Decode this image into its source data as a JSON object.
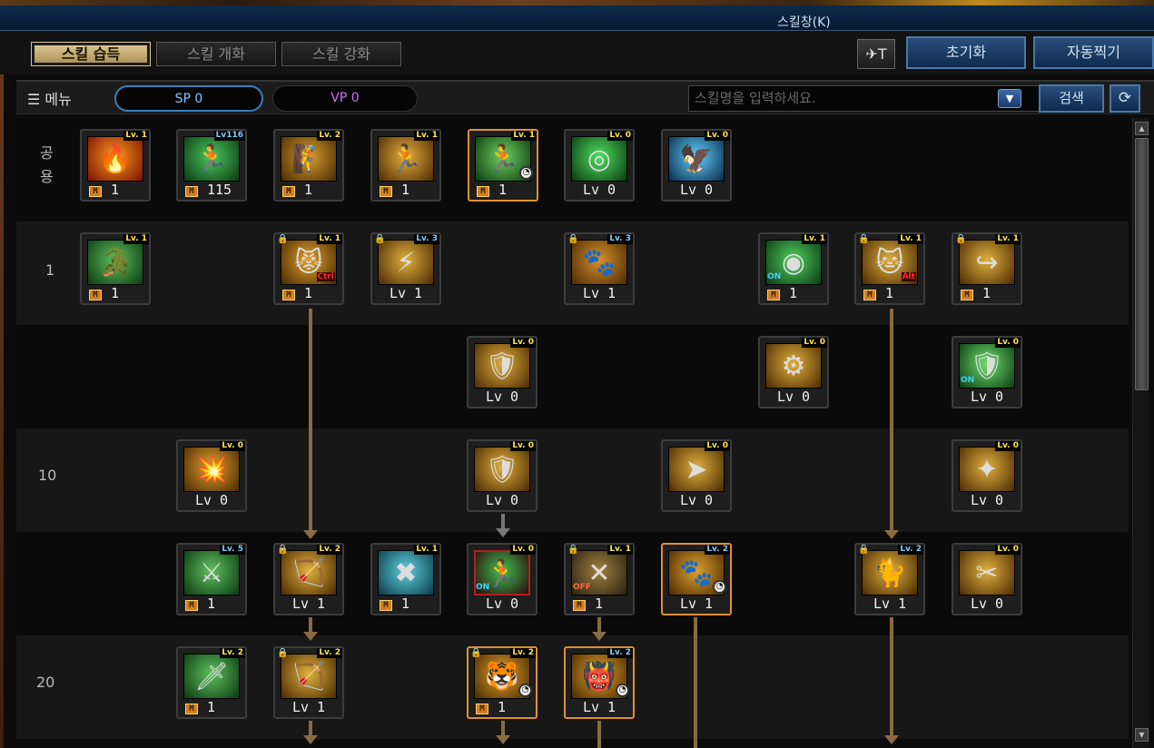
{
  "window": {
    "title": "스킬창(K)"
  },
  "tabs": [
    {
      "label": "스킬 습득",
      "active": true
    },
    {
      "label": "스킬 개화",
      "active": false
    },
    {
      "label": "스킬 강화",
      "active": false
    }
  ],
  "buttons": {
    "shortcut_icon": "✈T",
    "reset": "초기화",
    "auto": "자동찍기",
    "search": "검색",
    "refresh": "⟳"
  },
  "toolbar": {
    "menu": "☰ 메뉴",
    "sp": "SP 0",
    "vp": "VP 0",
    "search_placeholder": "스킬명을 입력하세요.",
    "dropdown": "▼"
  },
  "rows": [
    {
      "label": "공\n용"
    },
    {
      "label": "1"
    },
    {
      "label": ""
    },
    {
      "label": "10"
    },
    {
      "label": ""
    },
    {
      "label": "20"
    }
  ],
  "skills": [
    {
      "icon": "🔥",
      "badge": "Lv. 1",
      "bottom": "1",
      "master": true,
      "colors": [
        "#ff9a20",
        "#7a1000"
      ]
    },
    {
      "icon": "🏃",
      "badge": "Lv116",
      "bottom": "115",
      "master": true,
      "colors": [
        "#4cc860",
        "#0a3a10"
      ],
      "badge_blue": true
    },
    {
      "icon": "🧗",
      "badge": "Lv. 2",
      "bottom": "1",
      "master": true,
      "colors": [
        "#d8a030",
        "#4a2a00"
      ]
    },
    {
      "icon": "🏃",
      "badge": "Lv. 1",
      "bottom": "1",
      "master": true,
      "colors": [
        "#e8b040",
        "#4a2a00"
      ]
    },
    {
      "icon": "🏃",
      "badge": "Lv. 1",
      "bottom": "1",
      "master": true,
      "colors": [
        "#70d060",
        "#0a3a10"
      ],
      "clock": true,
      "orange": true
    },
    {
      "icon": "◎",
      "badge": "Lv. 0",
      "bottom": "Lv 0",
      "colors": [
        "#50e060",
        "#0a3a10"
      ]
    },
    {
      "icon": "🦅",
      "badge": "Lv. 0",
      "bottom": "Lv 0",
      "colors": [
        "#60d0ff",
        "#0a2a4a"
      ]
    },
    {
      "icon": "🐊",
      "badge": "Lv. 1",
      "bottom": "1",
      "master": true,
      "colors": [
        "#60c060",
        "#0a3a10"
      ]
    },
    {
      "icon": "😾",
      "badge": "Lv. 1",
      "bottom": "1",
      "master": true,
      "colors": [
        "#e0a030",
        "#4a2a00"
      ],
      "lock": true,
      "key": "Ctrl"
    },
    {
      "icon": "⚡",
      "badge": "Lv. 3",
      "bottom": "Lv 1",
      "colors": [
        "#e0b040",
        "#4a2a00"
      ],
      "lock": true,
      "badge_blue": true
    },
    {
      "icon": "🐾",
      "badge": "Lv. 3",
      "bottom": "Lv 1",
      "colors": [
        "#d89030",
        "#4a2a00"
      ],
      "lock": true,
      "badge_blue": true
    },
    {
      "icon": "◉",
      "badge": "Lv. 1",
      "bottom": "1",
      "master": true,
      "colors": [
        "#50d060",
        "#0a3a10"
      ],
      "on": true
    },
    {
      "icon": "🐱",
      "badge": "Lv. 1",
      "bottom": "1",
      "master": true,
      "colors": [
        "#e0b040",
        "#4a2a00"
      ],
      "lock": true,
      "key": "Alt"
    },
    {
      "icon": "↪",
      "badge": "Lv. 1",
      "bottom": "1",
      "master": true,
      "colors": [
        "#e0b040",
        "#4a2a00"
      ],
      "lock": true
    },
    {
      "icon": "🛡",
      "badge": "Lv. 0",
      "bottom": "Lv 0",
      "colors": [
        "#e0b040",
        "#4a2a00"
      ]
    },
    {
      "icon": "⚙",
      "badge": "Lv. 0",
      "bottom": "Lv 0",
      "colors": [
        "#e0b040",
        "#4a2a00"
      ]
    },
    {
      "icon": "🛡",
      "badge": "Lv. 0",
      "bottom": "Lv 0",
      "colors": [
        "#70e070",
        "#0a3a10"
      ],
      "on": true
    },
    {
      "icon": "💥",
      "badge": "Lv. 0",
      "bottom": "Lv 0",
      "colors": [
        "#e0a030",
        "#4a2a00"
      ]
    },
    {
      "icon": "🛡",
      "badge": "Lv. 0",
      "bottom": "Lv 0",
      "colors": [
        "#e0b040",
        "#4a2a00"
      ]
    },
    {
      "icon": "➤",
      "badge": "Lv. 0",
      "bottom": "Lv 0",
      "colors": [
        "#e0b040",
        "#4a2a00"
      ]
    },
    {
      "icon": "✦",
      "badge": "Lv. 0",
      "bottom": "Lv 0",
      "colors": [
        "#e0b040",
        "#4a2a00"
      ]
    },
    {
      "icon": "⚔",
      "badge": "Lv. 5",
      "bottom": "1",
      "master": true,
      "colors": [
        "#60c060",
        "#0a3a10"
      ],
      "badge_blue": true
    },
    {
      "icon": "🏹",
      "badge": "Lv. 2",
      "bottom": "Lv 1",
      "colors": [
        "#e0b040",
        "#4a2a00"
      ],
      "lock": true
    },
    {
      "icon": "✖",
      "badge": "Lv. 1",
      "bottom": "1",
      "master": true,
      "colors": [
        "#60d0e0",
        "#0a3a4a"
      ]
    },
    {
      "icon": "🏃",
      "badge": "Lv. 0",
      "bottom": "Lv 0",
      "colors": [
        "#40c050",
        "#2a0a0a"
      ],
      "on": true,
      "red": true
    },
    {
      "icon": "✕",
      "badge": "Lv. 1",
      "bottom": "1",
      "master": true,
      "colors": [
        "#a08040",
        "#2a2010"
      ],
      "lock": true,
      "off": true
    },
    {
      "icon": "🐾",
      "badge": "Lv. 2",
      "bottom": "Lv 1",
      "colors": [
        "#e0a030",
        "#4a2a00"
      ],
      "clock": true,
      "orange": true,
      "badge_blue": true
    },
    {
      "icon": "🐈",
      "badge": "Lv. 2",
      "bottom": "Lv 1",
      "colors": [
        "#e0b040",
        "#4a2a00"
      ],
      "lock": true,
      "badge_blue": true
    },
    {
      "icon": "✂",
      "badge": "Lv. 0",
      "bottom": "Lv 0",
      "colors": [
        "#e0b040",
        "#4a2a00"
      ]
    },
    {
      "icon": "🗡",
      "badge": "Lv. 2",
      "bottom": "1",
      "master": true,
      "colors": [
        "#60c060",
        "#0a3a10"
      ]
    },
    {
      "icon": "🏹",
      "badge": "Lv. 2",
      "bottom": "Lv 1",
      "colors": [
        "#e0b040",
        "#4a2a00"
      ],
      "lock": true
    },
    {
      "icon": "🐯",
      "badge": "Lv. 2",
      "bottom": "1",
      "master": true,
      "colors": [
        "#e0a030",
        "#4a2a00"
      ],
      "lock": true,
      "clock": true,
      "orange": true
    },
    {
      "icon": "👹",
      "badge": "Lv. 2",
      "bottom": "Lv 1",
      "colors": [
        "#e0a030",
        "#4a2a00"
      ],
      "clock": true,
      "orange": true,
      "badge_blue": true
    }
  ]
}
